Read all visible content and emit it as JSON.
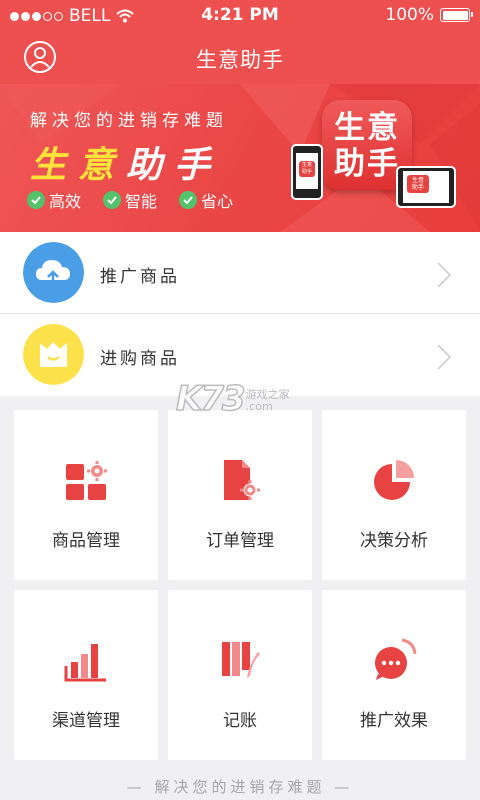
{
  "status_bar": {
    "carrier": "BELL",
    "time": "4:21 PM",
    "battery": "100%"
  },
  "nav": {
    "title": "生意助手"
  },
  "banner": {
    "subtitle": "解决您的进销存难题",
    "headline_part1": "生意",
    "headline_part2": "助手",
    "features": [
      "高效",
      "智能",
      "省心"
    ],
    "logo_line1": "生意",
    "logo_line2": "助手",
    "mini_logo_text": "生意助手"
  },
  "list": [
    {
      "label": "推广商品",
      "icon": "cloud-upload-icon"
    },
    {
      "label": "进购商品",
      "icon": "shopping-bag-icon"
    }
  ],
  "grid": [
    {
      "label": "商品管理",
      "icon": "goods-grid-gear-icon"
    },
    {
      "label": "订单管理",
      "icon": "order-document-gear-icon"
    },
    {
      "label": "决策分析",
      "icon": "pie-chart-icon"
    },
    {
      "label": "渠道管理",
      "icon": "bar-chart-icon"
    },
    {
      "label": "记账",
      "icon": "ledger-pen-icon"
    },
    {
      "label": "推广效果",
      "icon": "chat-broadcast-icon"
    }
  ],
  "footer": {
    "text": "— 解决您的进销存难题 —"
  },
  "watermark": {
    "big": "K73",
    "small_line1": "游戏之家",
    "small_line2": ".com"
  },
  "colors": {
    "brand_red": "#ee4f4f",
    "accent_yellow": "#ffe33a",
    "check_green": "#53c26a",
    "cloud_blue": "#4a9ee6",
    "bag_yellow": "#fde14b"
  }
}
